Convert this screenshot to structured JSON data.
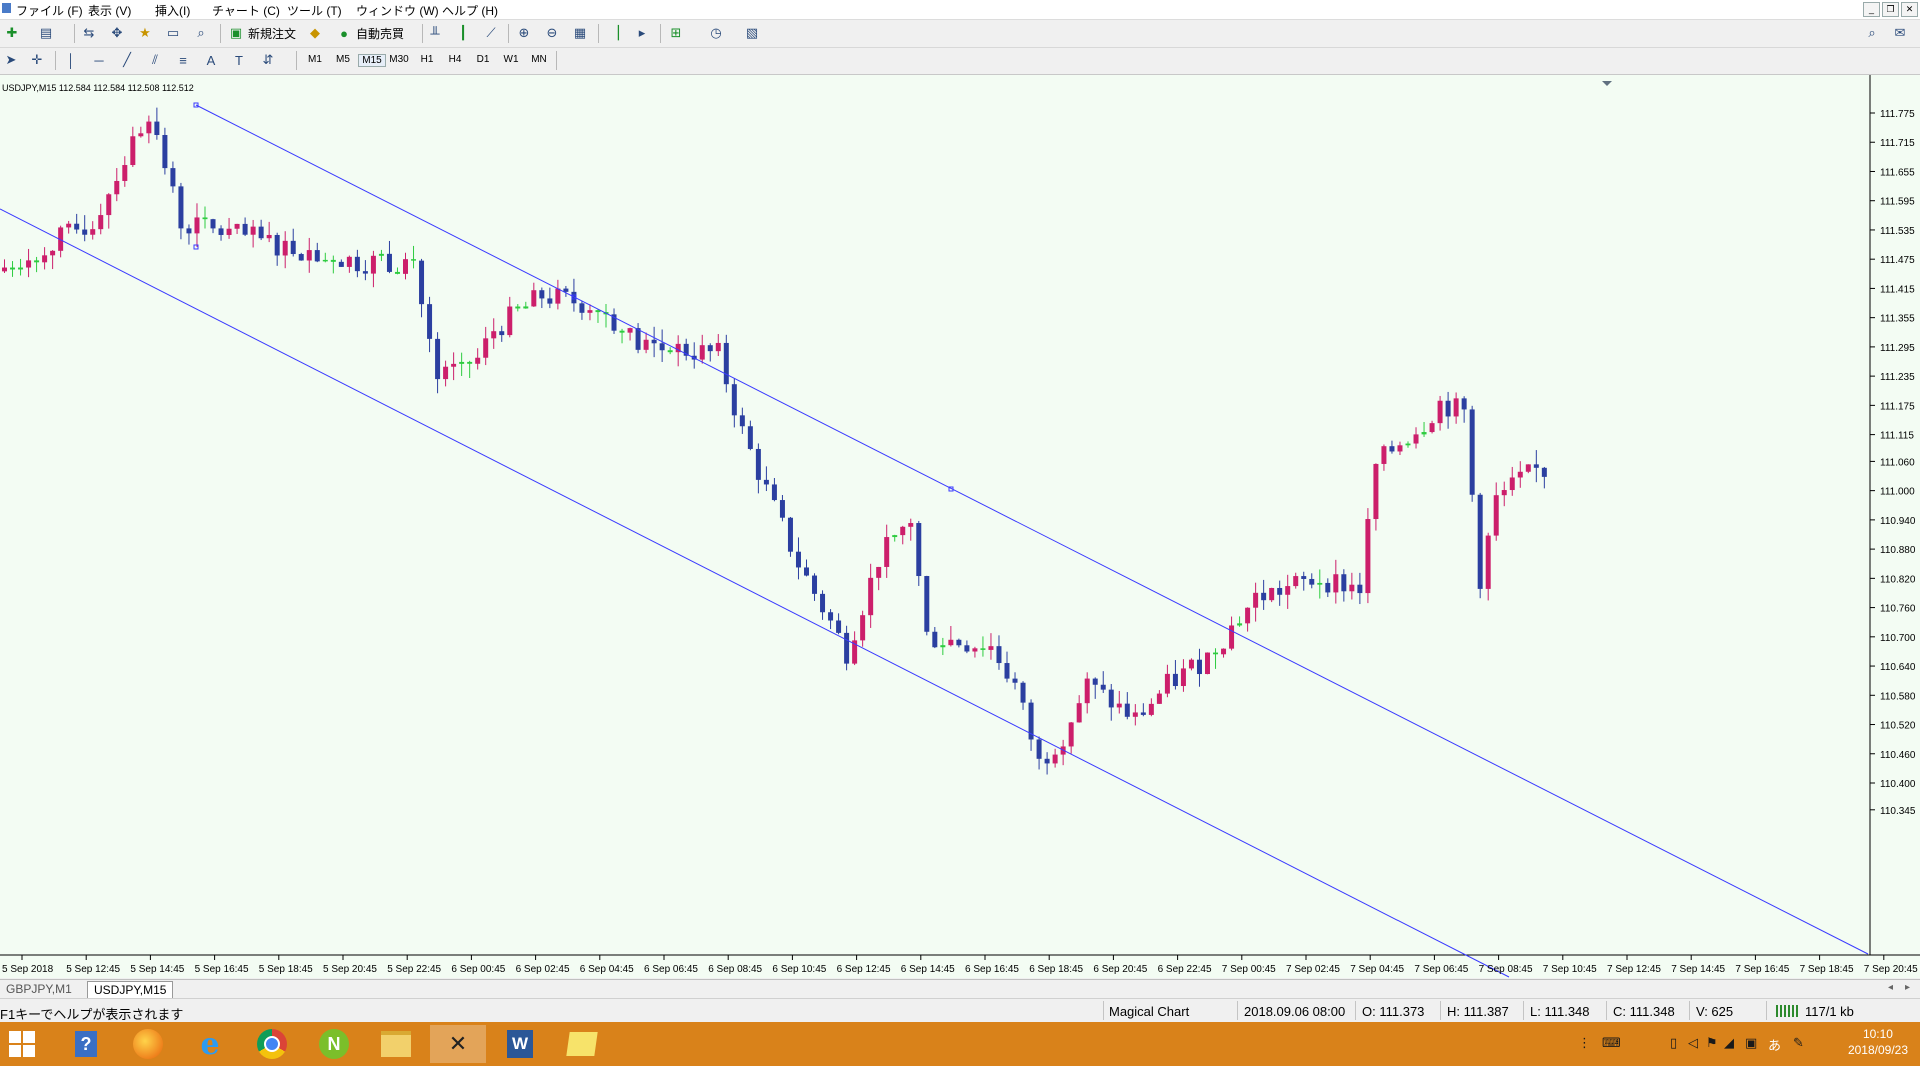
{
  "menu": [
    "ファイル (F)",
    "表示 (V)",
    "挿入(I)",
    "チャート (C)",
    "ツール (T)",
    "ウィンドウ (W)",
    "ヘルプ (H)"
  ],
  "toolbar": {
    "new_order": "新規注文",
    "auto_trade": "自動売買"
  },
  "timeframes": [
    "M1",
    "M5",
    "M15",
    "M30",
    "H1",
    "H4",
    "D1",
    "W1",
    "MN"
  ],
  "chart": {
    "header": "USDJPY,M15  112.584 112.584 112.508 112.512",
    "price_ticks": [
      "111.775",
      "111.715",
      "111.655",
      "111.595",
      "111.535",
      "111.475",
      "111.415",
      "111.355",
      "111.295",
      "111.235",
      "111.175",
      "111.115",
      "111.060",
      "111.000",
      "110.940",
      "110.880",
      "110.820",
      "110.760",
      "110.700",
      "110.640",
      "110.580",
      "110.520",
      "110.460",
      "110.400",
      "110.345"
    ],
    "time_ticks": [
      "5 Sep 2018",
      "5 Sep 12:45",
      "5 Sep 14:45",
      "5 Sep 16:45",
      "5 Sep 18:45",
      "5 Sep 20:45",
      "5 Sep 22:45",
      "6 Sep 00:45",
      "6 Sep 02:45",
      "6 Sep 04:45",
      "6 Sep 06:45",
      "6 Sep 08:45",
      "6 Sep 10:45",
      "6 Sep 12:45",
      "6 Sep 14:45",
      "6 Sep 16:45",
      "6 Sep 18:45",
      "6 Sep 20:45",
      "6 Sep 22:45",
      "7 Sep 00:45",
      "7 Sep 02:45",
      "7 Sep 04:45",
      "7 Sep 06:45",
      "7 Sep 08:45",
      "7 Sep 10:45",
      "7 Sep 12:45",
      "7 Sep 14:45",
      "7 Sep 16:45",
      "7 Sep 18:45",
      "7 Sep 20:45"
    ],
    "colors": {
      "bull": "#cc1f6b",
      "bear": "#2b3fa0",
      "doji": "#2ecc40",
      "channel": "#3a3aff",
      "background": "#f3fcf3"
    }
  },
  "tabs": [
    {
      "label": "GBPJPY,M1",
      "active": false
    },
    {
      "label": "USDJPY,M15",
      "active": true
    }
  ],
  "status": {
    "help": "F1キーでヘルプが表示されます",
    "profile": "Magical Chart",
    "datetime": "2018.09.06 08:00",
    "open": "O: 111.373",
    "high": "H: 111.387",
    "low": "L: 111.348",
    "close": "C: 111.348",
    "volume": "V: 625",
    "connection": "117/1 kb"
  },
  "taskbar": {
    "ime": "あ",
    "time": "10:10",
    "date": "2018/09/23"
  }
}
